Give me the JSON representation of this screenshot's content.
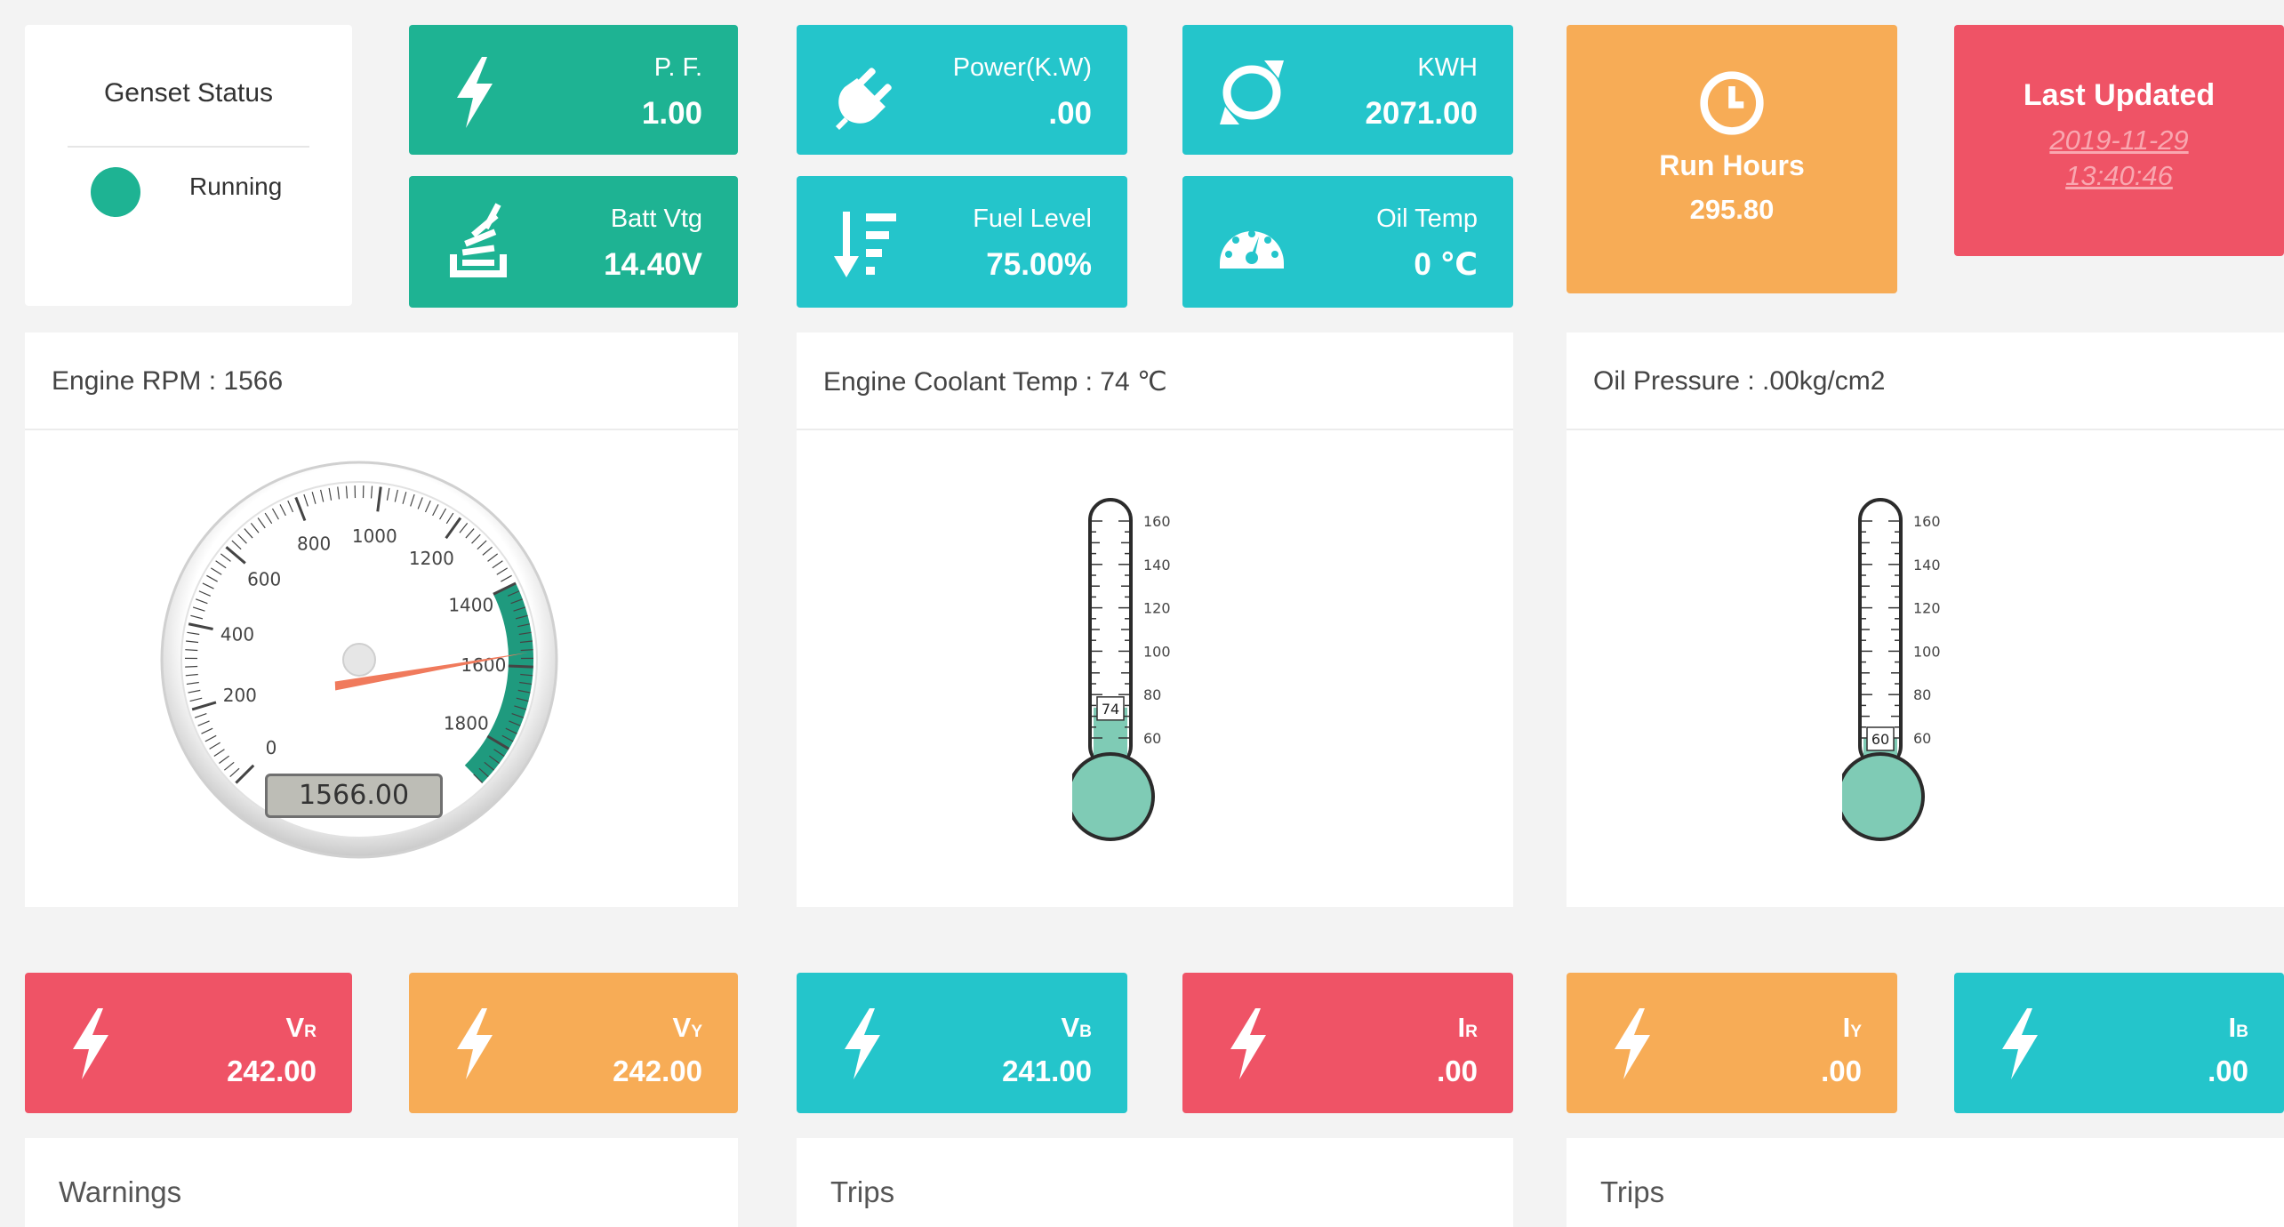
{
  "status": {
    "title": "Genset Status",
    "state": "Running",
    "dot_color": "#1eb393"
  },
  "tiles_top": {
    "pf": {
      "label": "P. F.",
      "value": "1.00"
    },
    "power": {
      "label": "Power(K.W)",
      "value": ".00"
    },
    "kwh": {
      "label": "KWH",
      "value": "2071.00"
    },
    "batt": {
      "label": "Batt Vtg",
      "value": "14.40V"
    },
    "fuel": {
      "label": "Fuel Level",
      "value": "75.00%"
    },
    "oil_temp": {
      "label": "Oil Temp",
      "value": "0 ℃"
    }
  },
  "run_hours": {
    "label": "Run Hours",
    "value": "295.80"
  },
  "last_updated": {
    "label": "Last Updated",
    "date": "2019-11-29",
    "time": "13:40:46"
  },
  "panels": {
    "rpm": {
      "title": "Engine RPM : 1566",
      "readout": "1566.00",
      "value": 1566,
      "min": 0,
      "max": 1900,
      "ticks": [
        "0",
        "200",
        "400",
        "600",
        "800",
        "1000",
        "1200",
        "1400",
        "1600",
        "1800"
      ]
    },
    "coolant": {
      "title": "Engine Coolant Temp : 74 ℃",
      "value": 74,
      "value_label": "74",
      "ticks": [
        "60",
        "80",
        "100",
        "120",
        "140",
        "160"
      ]
    },
    "oil": {
      "title": "Oil Pressure : .00kg/cm2",
      "value": 60,
      "value_label": "60",
      "ticks": [
        "60",
        "80",
        "100",
        "120",
        "140",
        "160"
      ]
    }
  },
  "tiles_bottom": {
    "vr": {
      "main": "V",
      "sub": "R",
      "value": "242.00"
    },
    "vy": {
      "main": "V",
      "sub": "Y",
      "value": "242.00"
    },
    "vb": {
      "main": "V",
      "sub": "B",
      "value": "241.00"
    },
    "ir": {
      "main": "I",
      "sub": "R",
      "value": ".00"
    },
    "iy": {
      "main": "I",
      "sub": "Y",
      "value": ".00"
    },
    "ib": {
      "main": "I",
      "sub": "B",
      "value": ".00"
    }
  },
  "sections": {
    "warnings": "Warnings",
    "trips1": "Trips",
    "trips2": "Trips"
  },
  "icons": {
    "bolt": "bolt-icon",
    "plug": "plug-icon",
    "meter": "gauge-icon",
    "stack": "stack-icon",
    "sort": "sort-down-icon",
    "sync": "refresh-icon",
    "clock": "clock-icon"
  },
  "colors": {
    "green": "#1eb393",
    "cyan": "#24c5cb",
    "orange": "#f7ac56",
    "red": "#ef5366",
    "thermo_fill": "#7fcbb5"
  }
}
